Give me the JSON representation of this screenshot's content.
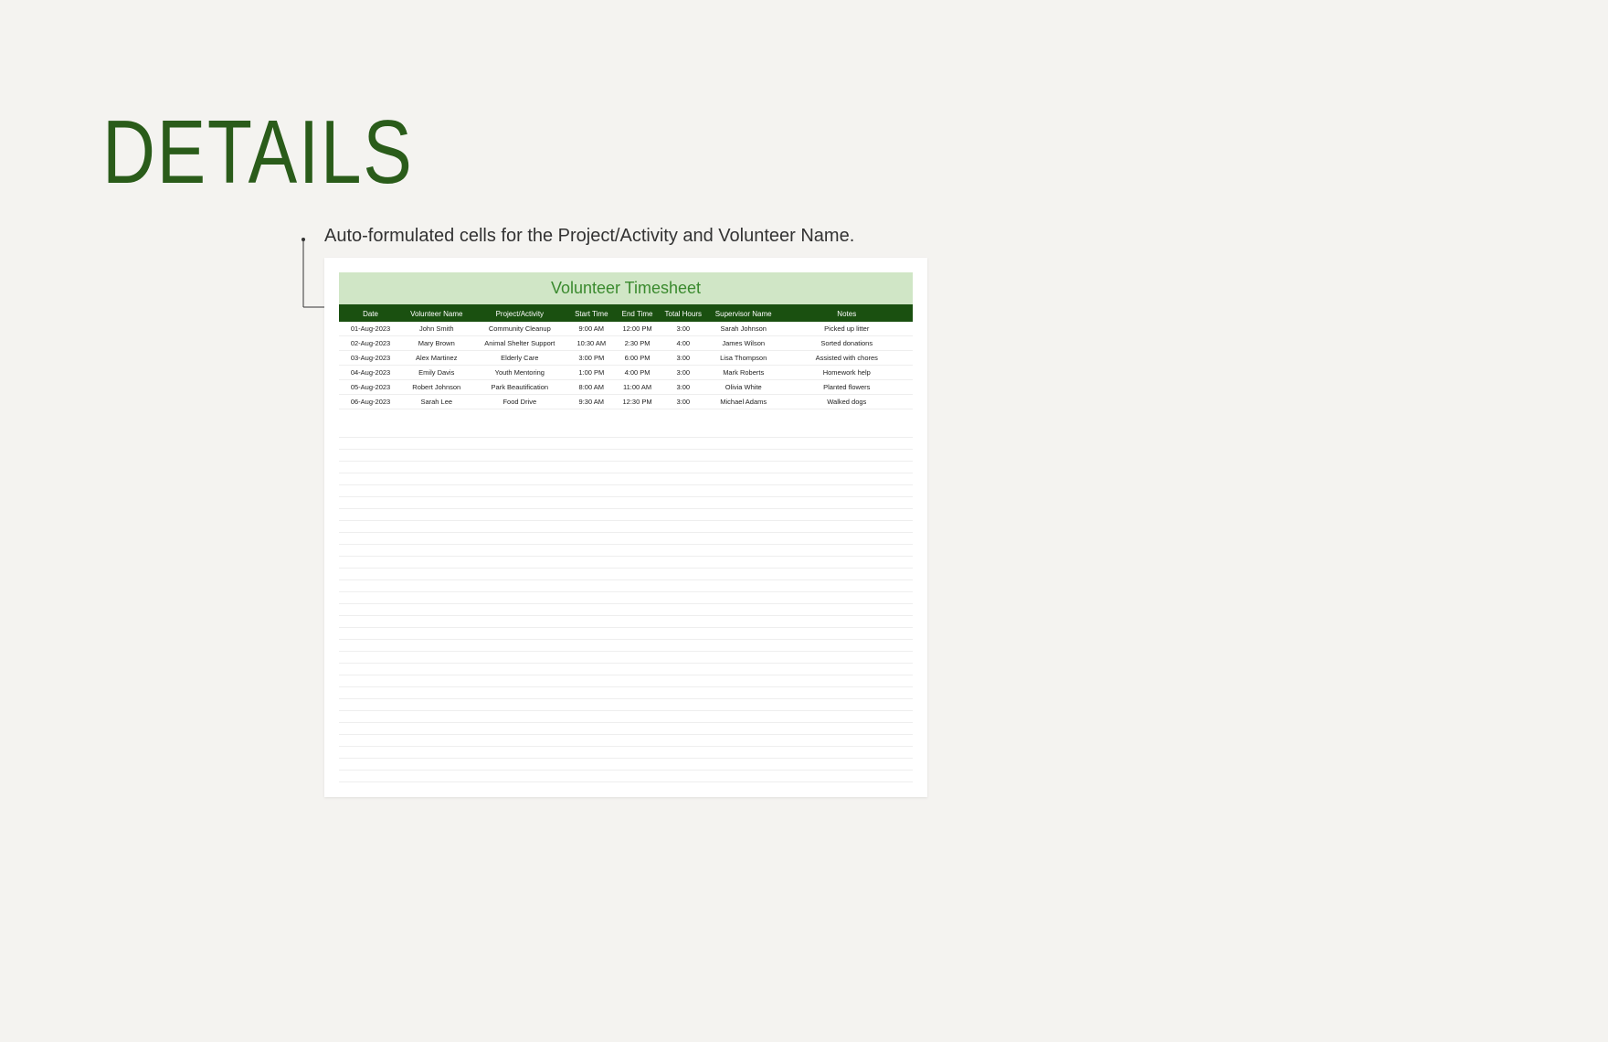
{
  "page": {
    "title": "DETAILS",
    "description": "Auto-formulated cells for the Project/Activity and Volunteer Name."
  },
  "sheet": {
    "title": "Volunteer Timesheet",
    "columns": [
      "Date",
      "Volunteer Name",
      "Project/Activity",
      "Start Time",
      "End Time",
      "Total Hours",
      "Supervisor Name",
      "Notes"
    ],
    "rows": [
      {
        "date": "01-Aug-2023",
        "name": "John Smith",
        "project": "Community Cleanup",
        "start": "9:00 AM",
        "end": "12:00 PM",
        "total": "3:00",
        "supervisor": "Sarah Johnson",
        "notes": "Picked up litter"
      },
      {
        "date": "02-Aug-2023",
        "name": "Mary Brown",
        "project": "Animal Shelter Support",
        "start": "10:30 AM",
        "end": "2:30 PM",
        "total": "4:00",
        "supervisor": "James Wilson",
        "notes": "Sorted donations"
      },
      {
        "date": "03-Aug-2023",
        "name": "Alex Martinez",
        "project": "Elderly Care",
        "start": "3:00 PM",
        "end": "6:00 PM",
        "total": "3:00",
        "supervisor": "Lisa Thompson",
        "notes": "Assisted with chores"
      },
      {
        "date": "04-Aug-2023",
        "name": "Emily Davis",
        "project": "Youth Mentoring",
        "start": "1:00 PM",
        "end": "4:00 PM",
        "total": "3:00",
        "supervisor": "Mark Roberts",
        "notes": "Homework help"
      },
      {
        "date": "05-Aug-2023",
        "name": "Robert Johnson",
        "project": "Park Beautification",
        "start": "8:00 AM",
        "end": "11:00 AM",
        "total": "3:00",
        "supervisor": "Olivia White",
        "notes": "Planted flowers"
      },
      {
        "date": "06-Aug-2023",
        "name": "Sarah Lee",
        "project": "Food Drive",
        "start": "9:30 AM",
        "end": "12:30 PM",
        "total": "3:00",
        "supervisor": "Michael Adams",
        "notes": "Walked dogs"
      }
    ],
    "empty_row_count": 30
  }
}
